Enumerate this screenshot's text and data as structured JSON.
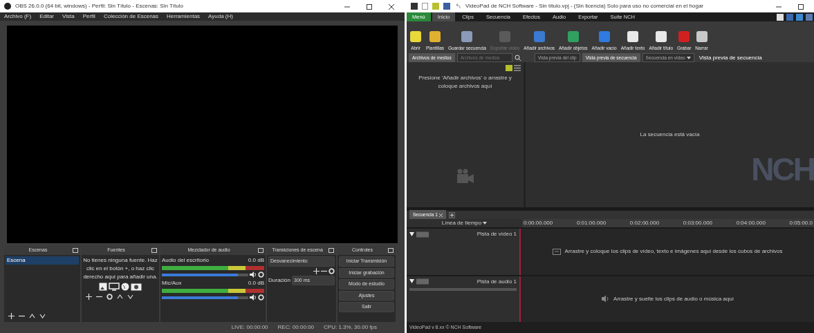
{
  "obs": {
    "title": "OBS 26.0.0 (64 bit, windows) - Perfil: Sin Título - Escenas: Sin Título",
    "menu": [
      "Archivo (F)",
      "Editar",
      "Vista",
      "Perfil",
      "Colección de Escenas",
      "Herramientas",
      "Ayuda (H)"
    ],
    "scenes": {
      "title": "Escenas",
      "items": [
        {
          "label": "Escena",
          "selected": true
        }
      ]
    },
    "sources": {
      "title": "Fuentes",
      "empty_text": "No tienes ninguna fuente. Haz clic en el botón +, o haz clic derecho aquí para añadir una."
    },
    "mixer": {
      "title": "Mezclador de audio",
      "channels": [
        {
          "name": "Audio del escritorio",
          "reading": "0.0 dB",
          "level": 0.88
        },
        {
          "name": "Mic/Aux",
          "reading": "0.0 dB",
          "level": 0.88
        }
      ]
    },
    "transitions": {
      "title": "Transiciones de escena",
      "type": "Desvanecimiento",
      "duration_label": "Duración",
      "duration": "300 ms"
    },
    "controls": {
      "title": "Controles",
      "buttons": [
        "Iniciar Transmisión",
        "Iniciar grabación",
        "Modo de estudio",
        "Ajustes",
        "Salir"
      ]
    },
    "status_bar": [
      "LIVE: 00:00:00",
      "REC: 00:00:00",
      "CPU: 1.3%, 30.00 fps"
    ]
  },
  "videopad": {
    "title": "VideoPad de NCH Software - Sin título.vpj - (Sin licencia) Solo para uso no comercial en el hogar",
    "tabs": [
      {
        "label": "Menú",
        "kind": "menu",
        "selected": false
      },
      {
        "label": "Inicio",
        "kind": "tab",
        "selected": true
      },
      {
        "label": "Clips",
        "kind": "tab",
        "selected": false
      },
      {
        "label": "Secuencia",
        "kind": "tab",
        "selected": false
      },
      {
        "label": "Efectos",
        "kind": "tab",
        "selected": false
      },
      {
        "label": "Audio",
        "kind": "tab",
        "selected": false
      },
      {
        "label": "Exportar",
        "kind": "tab",
        "selected": false
      },
      {
        "label": "Suite NCH",
        "kind": "tab",
        "selected": false
      }
    ],
    "toolbar": [
      {
        "label": "Abrir",
        "color": "#e8d83a",
        "disabled": false
      },
      {
        "label": "Plantillas",
        "color": "#e0b030",
        "disabled": false
      },
      {
        "label": "Guardar secuencia",
        "color": "#8a9ab8",
        "disabled": false
      },
      {
        "label": "Exportar vídeo",
        "color": "#5a5a5a",
        "disabled": true
      },
      {
        "label": "Añadir archivos",
        "color": "#3a7ad0",
        "disabled": false
      },
      {
        "label": "Añadir objetos",
        "color": "#30a060",
        "disabled": false
      },
      {
        "label": "Añadir vacío",
        "color": "#2f7ae0",
        "disabled": false
      },
      {
        "label": "Añadir texto",
        "color": "#e8e8e8",
        "disabled": false
      },
      {
        "label": "Añadir título",
        "color": "#e8e8e8",
        "disabled": false
      },
      {
        "label": "Grabar",
        "color": "#d02020",
        "disabled": false
      },
      {
        "label": "Narrar",
        "color": "#c8c8c8",
        "disabled": false
      }
    ],
    "media": {
      "tab": "Archivos de medios",
      "search_placeholder": "Archivos de medios",
      "hint": "Presione 'Añadir archivos' o arrastre y coloque archivos aquí"
    },
    "preview_tabs": [
      {
        "label": "Vista previa del clip",
        "selected": false
      },
      {
        "label": "Vista previa de secuencia",
        "selected": true
      }
    ],
    "preview_mode": "Secuencia en vídeo",
    "preview_title": "Vista previa de secuencia",
    "preview_empty": "La secuencia está vacía",
    "logo": "NCH",
    "timeline": {
      "tab": "Secuencia 1",
      "mode": "Línea de tiempo",
      "ticks": [
        "0:00:00.000",
        "0:01:00.000",
        "0:02:00.000",
        "0:03:00.000",
        "0:04:00.000",
        "0:05:00.0"
      ],
      "tracks": [
        {
          "kind": "video",
          "name": "Pista de vídeo 1",
          "hint": "Arrastre y coloque los clips de vídeo, texto e imágenes aquí desde los cubos de archivos"
        },
        {
          "kind": "audio",
          "name": "Pista de audio 1",
          "hint": "Arrastre y suelte los clips de audio o música aquí"
        }
      ]
    },
    "status": "VideoPad v 8.xx © NCH Software"
  }
}
